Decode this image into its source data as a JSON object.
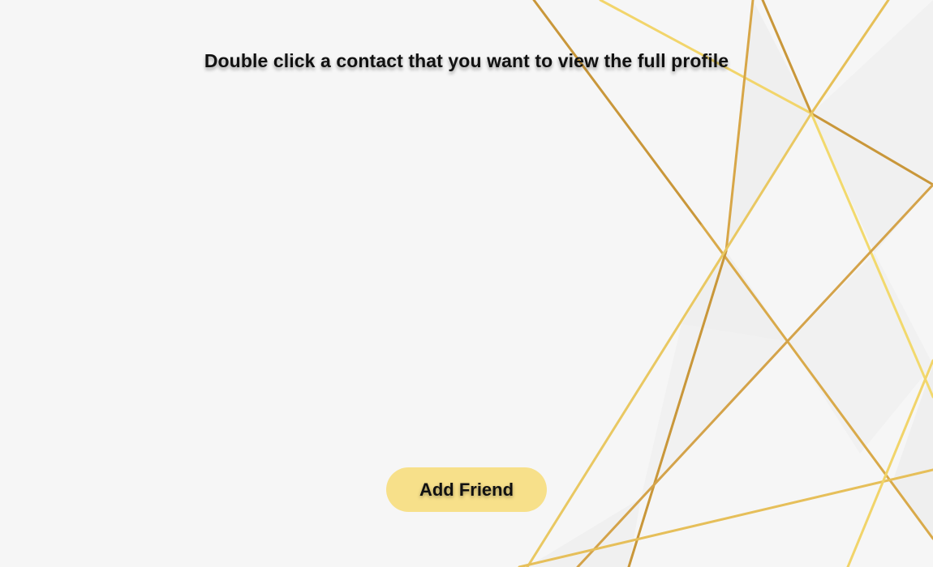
{
  "instruction_text": "Double click a contact that you want to view the full profile",
  "add_friend_button": {
    "label": "Add Friend",
    "color": "#f7e08a"
  },
  "contacts": [],
  "theme": {
    "background": "#f6f6f6",
    "gold_dark": "#c9973a",
    "gold_light": "#f5dc70"
  }
}
